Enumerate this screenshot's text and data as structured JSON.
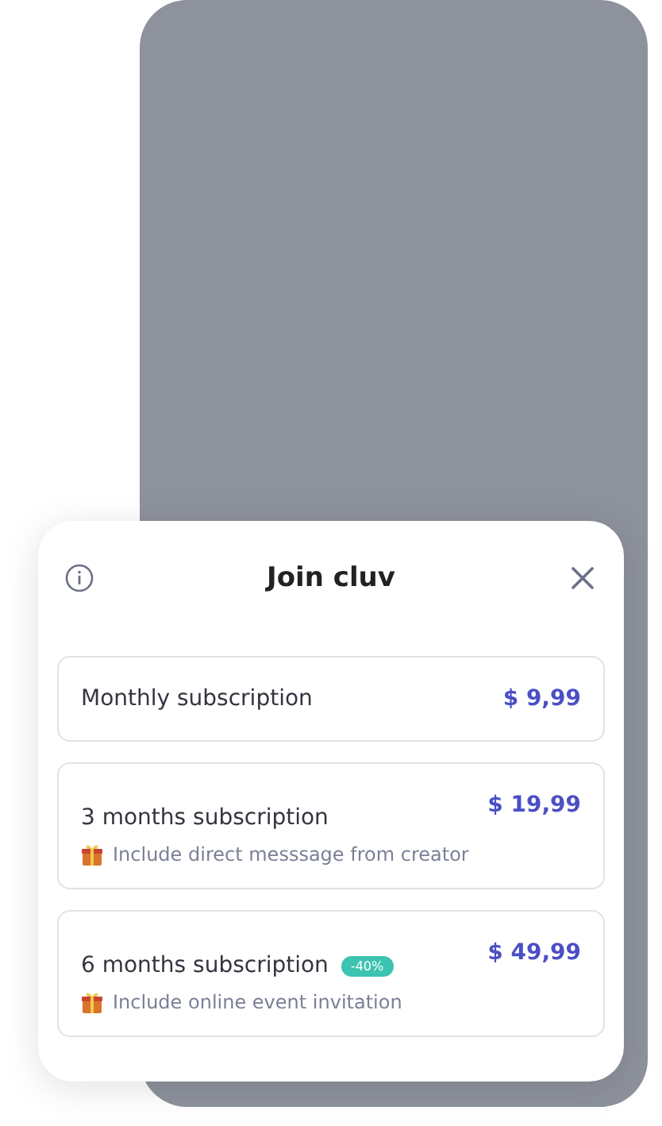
{
  "dialog": {
    "title": "Join cluv"
  },
  "plans": [
    {
      "name": "Monthly subscription",
      "price": "$ 9,99"
    },
    {
      "name": "3 months subscription",
      "price": "$ 19,99",
      "perk": "Include direct messsage from creator"
    },
    {
      "name": "6 months subscription",
      "price": "$ 49,99",
      "badge": "-40%",
      "perk": "Include online event invitation"
    }
  ]
}
